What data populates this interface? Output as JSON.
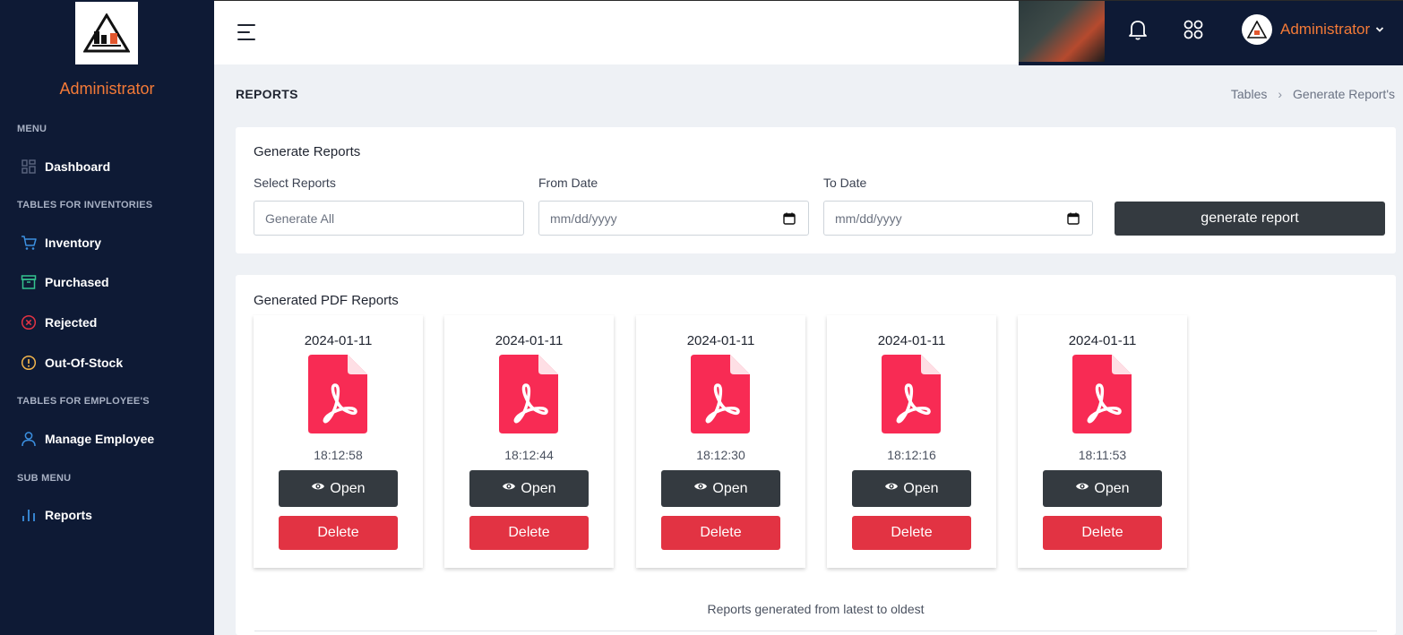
{
  "sidebar": {
    "user_name": "Administrator",
    "sections": {
      "menu": "MENU",
      "inventories": "TABLES FOR INVENTORIES",
      "employees": "TABLES FOR EMPLOYEE'S",
      "submenu": "SUB MENU"
    },
    "items": {
      "dashboard": {
        "label": "Dashboard",
        "icon": "dashboard-icon",
        "color": "#5c6680"
      },
      "inventory": {
        "label": "Inventory",
        "icon": "cart-icon",
        "color": "#3b8fe0"
      },
      "purchased": {
        "label": "Purchased",
        "icon": "archive-icon",
        "color": "#34c38f"
      },
      "rejected": {
        "label": "Rejected",
        "icon": "x-circle-icon",
        "color": "#e23343"
      },
      "out_of_stock": {
        "label": "Out-Of-Stock",
        "icon": "alert-circle-icon",
        "color": "#f1b44c"
      },
      "manage_employee": {
        "label": "Manage Employee",
        "icon": "user-icon",
        "color": "#3b8fe0"
      },
      "reports": {
        "label": "Reports",
        "icon": "bar-chart-icon",
        "color": "#3b8fe0"
      }
    }
  },
  "topbar": {
    "user_name": "Administrator",
    "accent": "#f47a37"
  },
  "page": {
    "title": "REPORTS",
    "breadcrumb": [
      "Tables",
      "Generate Report's"
    ]
  },
  "generate_card": {
    "title": "Generate Reports",
    "select_label": "Select Reports",
    "select_value": "Generate All",
    "from_label": "From Date",
    "from_placeholder": "mm/dd/yyyy",
    "to_label": "To Date",
    "to_placeholder": "mm/dd/yyyy",
    "button_label": "generate report"
  },
  "reports_card": {
    "title": "Generated PDF Reports",
    "open_label": "Open",
    "delete_label": "Delete",
    "reports": [
      {
        "date": "2024-01-11",
        "time": "18:12:58"
      },
      {
        "date": "2024-01-11",
        "time": "18:12:44"
      },
      {
        "date": "2024-01-11",
        "time": "18:12:30"
      },
      {
        "date": "2024-01-11",
        "time": "18:12:16"
      },
      {
        "date": "2024-01-11",
        "time": "18:11:53"
      }
    ],
    "footnote": "Reports generated from latest to oldest"
  },
  "colors": {
    "sidebar_bg": "#0e1a35",
    "pdf_red": "#f82b54",
    "dark_button": "#343a40",
    "danger": "#e23343"
  }
}
